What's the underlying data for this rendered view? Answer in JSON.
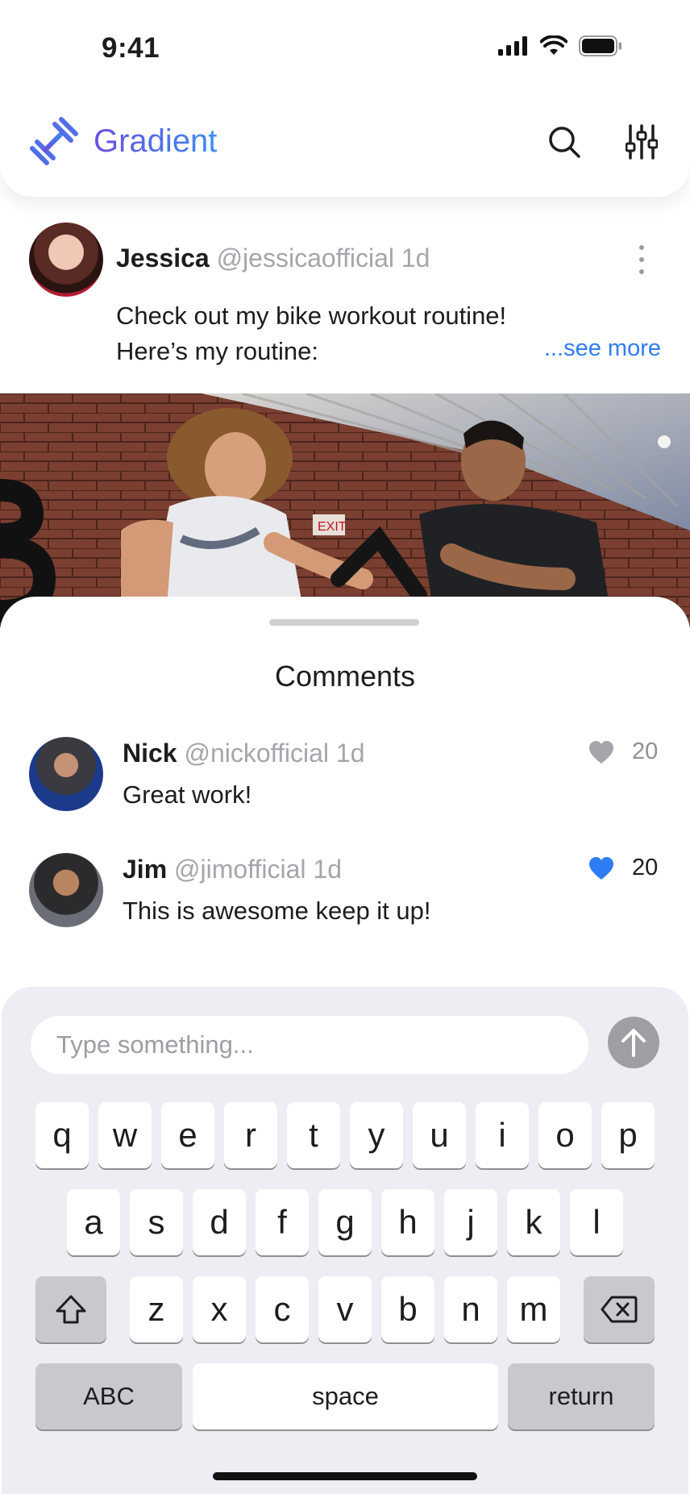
{
  "status_bar": {
    "time": "9:41"
  },
  "header": {
    "app_name": "Gradient",
    "accent_gradient": [
      "#6a4fe0",
      "#3b8ef0"
    ],
    "icons": [
      "dumbbell-logo-icon",
      "search-icon",
      "sliders-icon"
    ]
  },
  "post": {
    "author": "Jessica",
    "handle": "@jessicaofficial",
    "age": "1d",
    "text_line1": "Check out my bike workout routine!",
    "text_line2": "Here’s my routine:",
    "see_more": "...see more"
  },
  "comments_sheet": {
    "title": "Comments",
    "comments": [
      {
        "author": "Nick",
        "handle": "@nickofficial",
        "age": "1d",
        "text": "Great work!",
        "likes": "20",
        "liked": false
      },
      {
        "author": "Jim",
        "handle": "@jimofficial",
        "age": "1d",
        "text": "This is awesome keep it up!",
        "likes": "20",
        "liked": true
      }
    ]
  },
  "composer": {
    "placeholder": "Type something..."
  },
  "keyboard": {
    "row1": [
      "q",
      "w",
      "e",
      "r",
      "t",
      "y",
      "u",
      "i",
      "o",
      "p"
    ],
    "row2": [
      "a",
      "s",
      "d",
      "f",
      "g",
      "h",
      "j",
      "k",
      "l"
    ],
    "row3": [
      "z",
      "x",
      "c",
      "v",
      "b",
      "n",
      "m"
    ],
    "abc_label": "ABC",
    "space_label": "space",
    "return_label": "return"
  },
  "colors": {
    "link": "#2f7df6",
    "liked_heart": "#2f7df6",
    "muted": "#a5a5ab",
    "keyboard_bg": "#eceef4"
  }
}
